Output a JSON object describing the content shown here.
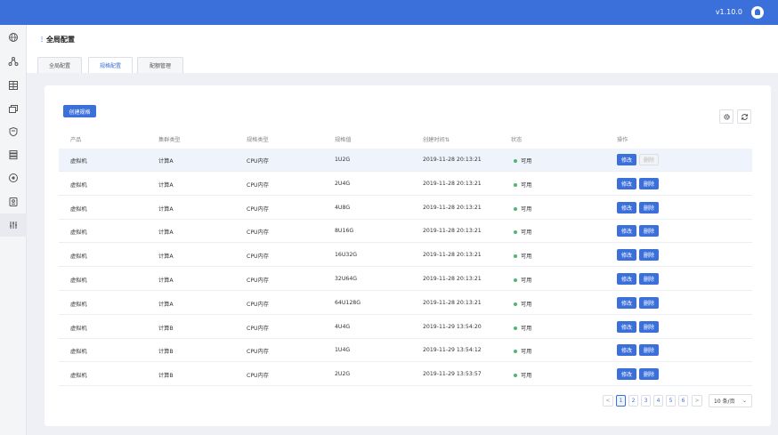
{
  "topbar": {
    "version": "v1.10.0"
  },
  "sidebar": {
    "icons": [
      "globe-icon",
      "network-icon",
      "grid-icon",
      "stack-icon",
      "shield-icon",
      "storage-icon",
      "compass-icon",
      "id-card-icon",
      "sliders-icon"
    ],
    "active_index": 8
  },
  "header": {
    "title_icon": "⫶",
    "title": "全局配置",
    "tabs": [
      {
        "label": "全局配置"
      },
      {
        "label": "规格配置"
      },
      {
        "label": "配额管理"
      }
    ],
    "active_tab": 1
  },
  "toolbar": {
    "create_label": "创建规格",
    "settings_icon": "gear-icon",
    "refresh_icon": "refresh-icon"
  },
  "table": {
    "headers": {
      "product": "产品",
      "cluster_type": "集群类型",
      "spec_type": "规格类型",
      "spec_value": "规格值",
      "created_at": "创建时间",
      "sort_icon": "⇅",
      "status": "状态",
      "actions": "操作"
    },
    "edit_label": "修改",
    "delete_label": "删除",
    "rows": [
      {
        "product": "虚拟机",
        "cluster_type": "计算A",
        "spec_type": "CPU内存",
        "spec_value": "1U2G",
        "created_at": "2019-11-28 20:13:21",
        "status": "可用",
        "delete_disabled": true
      },
      {
        "product": "虚拟机",
        "cluster_type": "计算A",
        "spec_type": "CPU内存",
        "spec_value": "2U4G",
        "created_at": "2019-11-28 20:13:21",
        "status": "可用"
      },
      {
        "product": "虚拟机",
        "cluster_type": "计算A",
        "spec_type": "CPU内存",
        "spec_value": "4U8G",
        "created_at": "2019-11-28 20:13:21",
        "status": "可用"
      },
      {
        "product": "虚拟机",
        "cluster_type": "计算A",
        "spec_type": "CPU内存",
        "spec_value": "8U16G",
        "created_at": "2019-11-28 20:13:21",
        "status": "可用"
      },
      {
        "product": "虚拟机",
        "cluster_type": "计算A",
        "spec_type": "CPU内存",
        "spec_value": "16U32G",
        "created_at": "2019-11-28 20:13:21",
        "status": "可用"
      },
      {
        "product": "虚拟机",
        "cluster_type": "计算A",
        "spec_type": "CPU内存",
        "spec_value": "32U64G",
        "created_at": "2019-11-28 20:13:21",
        "status": "可用"
      },
      {
        "product": "虚拟机",
        "cluster_type": "计算A",
        "spec_type": "CPU内存",
        "spec_value": "64U128G",
        "created_at": "2019-11-28 20:13:21",
        "status": "可用"
      },
      {
        "product": "虚拟机",
        "cluster_type": "计算B",
        "spec_type": "CPU内存",
        "spec_value": "4U4G",
        "created_at": "2019-11-29 13:54:20",
        "status": "可用"
      },
      {
        "product": "虚拟机",
        "cluster_type": "计算B",
        "spec_type": "CPU内存",
        "spec_value": "1U4G",
        "created_at": "2019-11-29 13:54:12",
        "status": "可用"
      },
      {
        "product": "虚拟机",
        "cluster_type": "计算B",
        "spec_type": "CPU内存",
        "spec_value": "2U2G",
        "created_at": "2019-11-29 13:53:57",
        "status": "可用"
      }
    ]
  },
  "pagination": {
    "prev": "<",
    "next": ">",
    "pages": [
      "1",
      "2",
      "3",
      "4",
      "5",
      "6"
    ],
    "current": "1",
    "page_size": "10 条/页",
    "page_size_chevron": "⌄"
  },
  "colors": {
    "primary": "#3b6fd9",
    "status_ok": "#4cb86e"
  }
}
